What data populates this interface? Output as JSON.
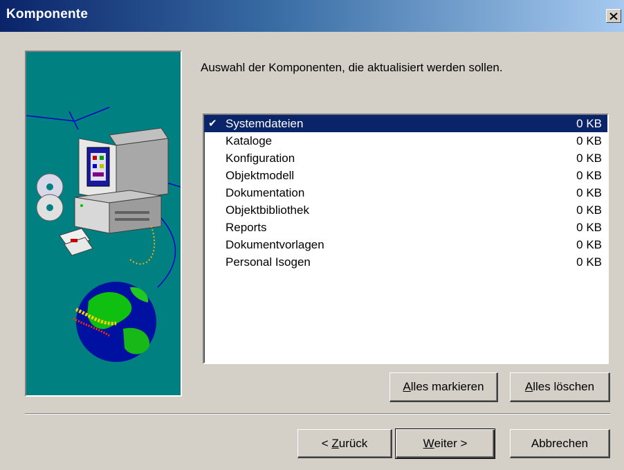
{
  "window": {
    "title": "Komponente",
    "close_glyph": "✕"
  },
  "instruction": "Auswahl der Komponenten, die aktualisiert werden sollen.",
  "components": [
    {
      "name": "Systemdateien",
      "size": "0 KB",
      "checked": true,
      "selected": true
    },
    {
      "name": "Kataloge",
      "size": "0 KB",
      "checked": false,
      "selected": false
    },
    {
      "name": "Konfiguration",
      "size": "0 KB",
      "checked": false,
      "selected": false
    },
    {
      "name": "Objektmodell",
      "size": "0 KB",
      "checked": false,
      "selected": false
    },
    {
      "name": "Dokumentation",
      "size": "0 KB",
      "checked": false,
      "selected": false
    },
    {
      "name": "Objektbibliothek",
      "size": "0 KB",
      "checked": false,
      "selected": false
    },
    {
      "name": "Reports",
      "size": "0 KB",
      "checked": false,
      "selected": false
    },
    {
      "name": "Dokumentvorlagen",
      "size": "0 KB",
      "checked": false,
      "selected": false
    },
    {
      "name": "Personal Isogen",
      "size": "0 KB",
      "checked": false,
      "selected": false
    }
  ],
  "check_glyph": "✔",
  "list_buttons": {
    "select_all": {
      "mnemonic": "A",
      "rest": "lles markieren"
    },
    "clear_all": {
      "mnemonic": "A",
      "rest": "lles löschen"
    }
  },
  "nav_buttons": {
    "back": {
      "prefix": "< ",
      "mnemonic": "Z",
      "rest": "urück"
    },
    "next": {
      "mnemonic": "W",
      "rest": "eiter >"
    },
    "cancel": "Abbrechen"
  },
  "icons": [
    "close-icon",
    "computer-icon",
    "cd-icon",
    "floppy-disk-icon",
    "globe-icon",
    "check-icon"
  ],
  "colors": {
    "title_start": "#0a246a",
    "title_end": "#a6caf0",
    "panel": "#008080",
    "selection": "#0a246a",
    "face": "#d4d0c8"
  }
}
